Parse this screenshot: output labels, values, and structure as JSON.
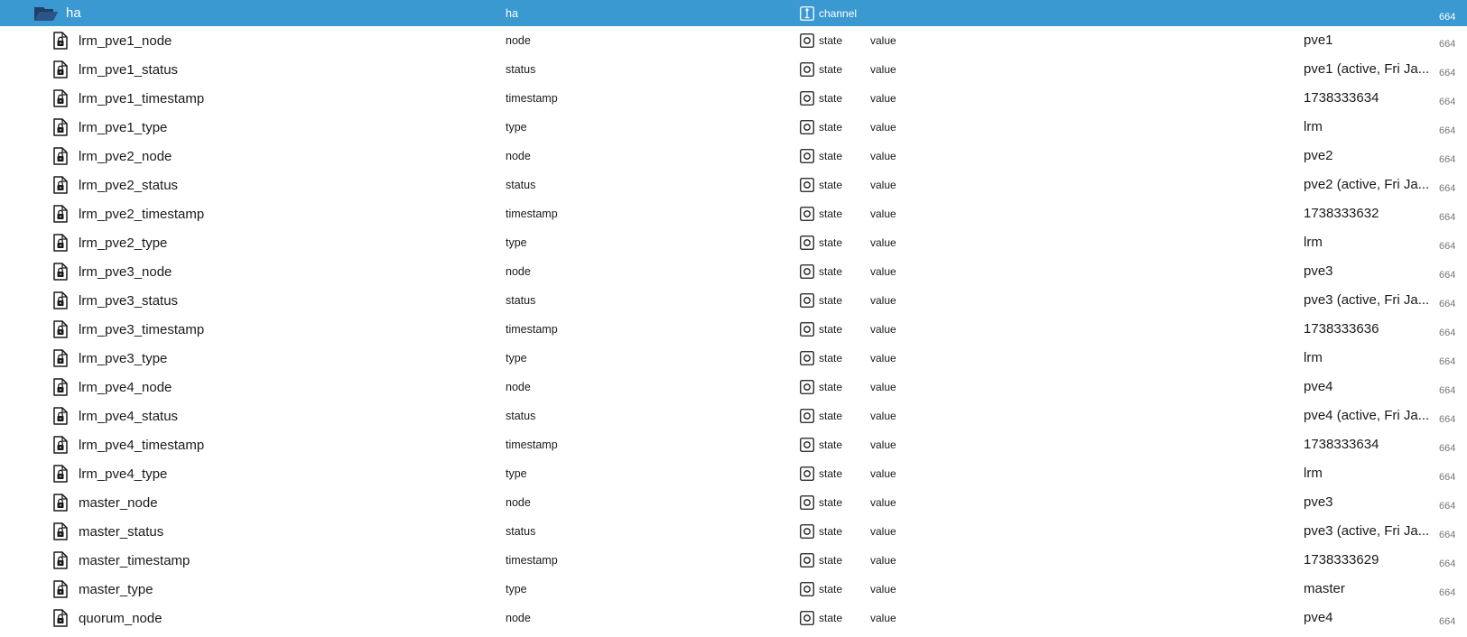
{
  "colors": {
    "selected_bg": "#3a99d0",
    "selected_text": "#ffffff",
    "folder_icon": "#1f3f66",
    "acl_text": "#777777"
  },
  "folder": {
    "name": "ha",
    "role": "ha",
    "type": "channel",
    "icon": "folder-open-icon",
    "type_icon": "channel-icon",
    "acl": "664"
  },
  "rows": [
    {
      "name": "lrm_pve1_node",
      "role": "node",
      "type": "state",
      "kind": "value",
      "value": "pve1",
      "acl": "664"
    },
    {
      "name": "lrm_pve1_status",
      "role": "status",
      "type": "state",
      "kind": "value",
      "value": "pve1 (active, Fri Ja...",
      "acl": "664"
    },
    {
      "name": "lrm_pve1_timestamp",
      "role": "timestamp",
      "type": "state",
      "kind": "value",
      "value": "1738333634",
      "acl": "664"
    },
    {
      "name": "lrm_pve1_type",
      "role": "type",
      "type": "state",
      "kind": "value",
      "value": "lrm",
      "acl": "664"
    },
    {
      "name": "lrm_pve2_node",
      "role": "node",
      "type": "state",
      "kind": "value",
      "value": "pve2",
      "acl": "664"
    },
    {
      "name": "lrm_pve2_status",
      "role": "status",
      "type": "state",
      "kind": "value",
      "value": "pve2 (active, Fri Ja...",
      "acl": "664"
    },
    {
      "name": "lrm_pve2_timestamp",
      "role": "timestamp",
      "type": "state",
      "kind": "value",
      "value": "1738333632",
      "acl": "664"
    },
    {
      "name": "lrm_pve2_type",
      "role": "type",
      "type": "state",
      "kind": "value",
      "value": "lrm",
      "acl": "664"
    },
    {
      "name": "lrm_pve3_node",
      "role": "node",
      "type": "state",
      "kind": "value",
      "value": "pve3",
      "acl": "664"
    },
    {
      "name": "lrm_pve3_status",
      "role": "status",
      "type": "state",
      "kind": "value",
      "value": "pve3 (active, Fri Ja...",
      "acl": "664"
    },
    {
      "name": "lrm_pve3_timestamp",
      "role": "timestamp",
      "type": "state",
      "kind": "value",
      "value": "1738333636",
      "acl": "664"
    },
    {
      "name": "lrm_pve3_type",
      "role": "type",
      "type": "state",
      "kind": "value",
      "value": "lrm",
      "acl": "664"
    },
    {
      "name": "lrm_pve4_node",
      "role": "node",
      "type": "state",
      "kind": "value",
      "value": "pve4",
      "acl": "664"
    },
    {
      "name": "lrm_pve4_status",
      "role": "status",
      "type": "state",
      "kind": "value",
      "value": "pve4 (active, Fri Ja...",
      "acl": "664"
    },
    {
      "name": "lrm_pve4_timestamp",
      "role": "timestamp",
      "type": "state",
      "kind": "value",
      "value": "1738333634",
      "acl": "664"
    },
    {
      "name": "lrm_pve4_type",
      "role": "type",
      "type": "state",
      "kind": "value",
      "value": "lrm",
      "acl": "664"
    },
    {
      "name": "master_node",
      "role": "node",
      "type": "state",
      "kind": "value",
      "value": "pve3",
      "acl": "664"
    },
    {
      "name": "master_status",
      "role": "status",
      "type": "state",
      "kind": "value",
      "value": "pve3 (active, Fri Ja...",
      "acl": "664"
    },
    {
      "name": "master_timestamp",
      "role": "timestamp",
      "type": "state",
      "kind": "value",
      "value": "1738333629",
      "acl": "664"
    },
    {
      "name": "master_type",
      "role": "type",
      "type": "state",
      "kind": "value",
      "value": "master",
      "acl": "664"
    },
    {
      "name": "quorum_node",
      "role": "node",
      "type": "state",
      "kind": "value",
      "value": "pve4",
      "acl": "664"
    }
  ]
}
